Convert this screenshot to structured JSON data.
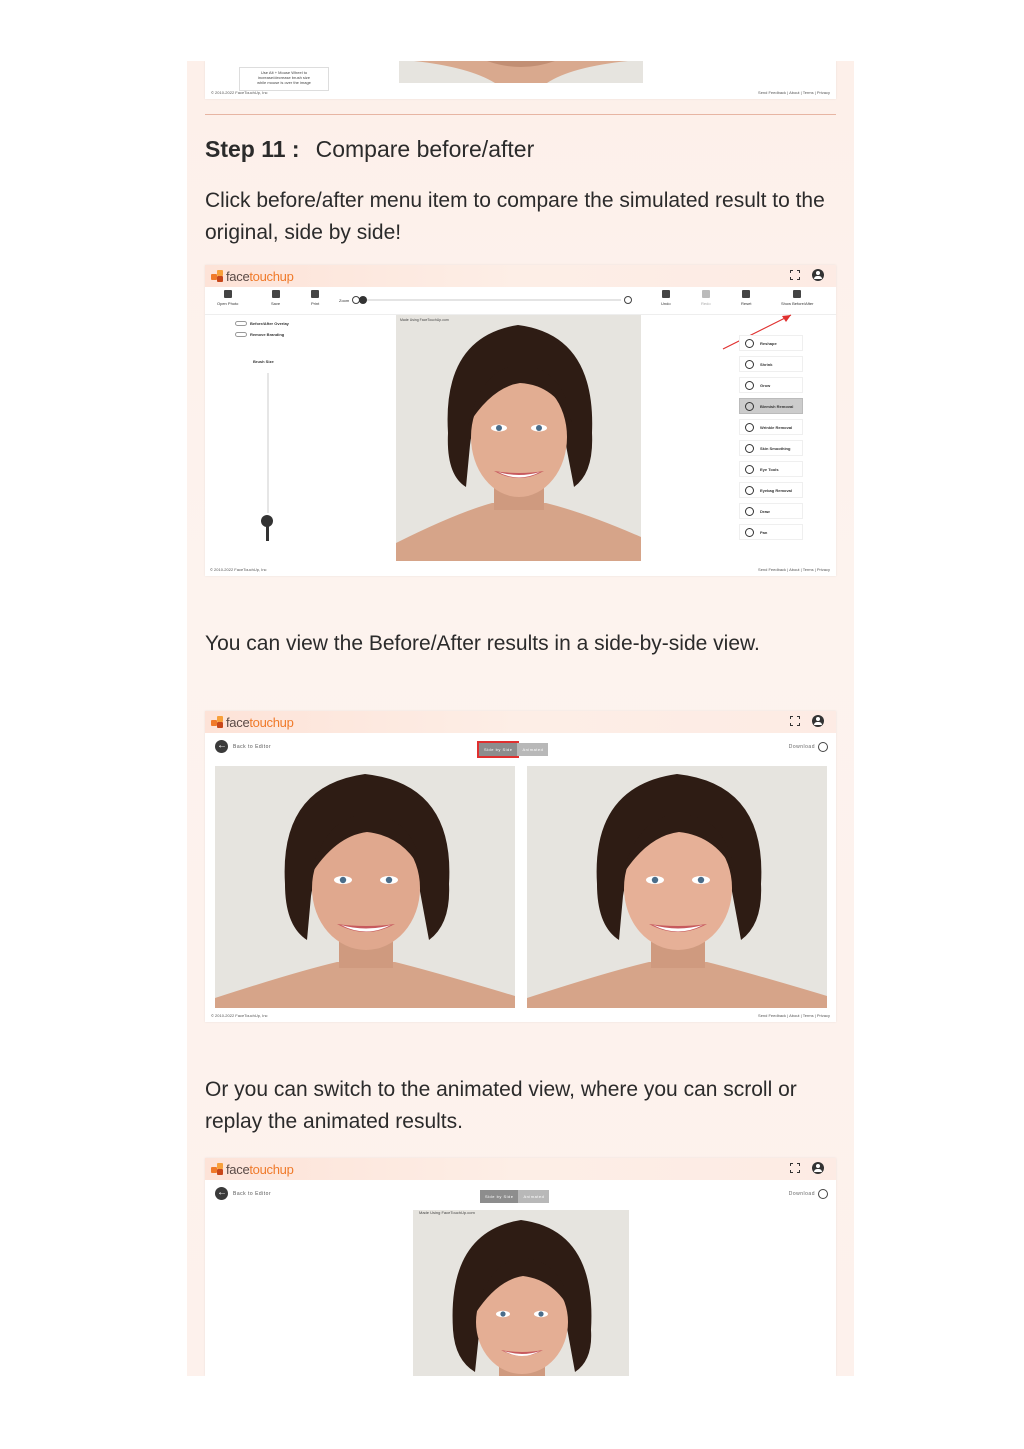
{
  "top_fragment": {
    "tip_line1": "Use Alt + Mouse Wheel to",
    "tip_line2": "increase/decrease brush size",
    "tip_line3": "while mouse is over the image",
    "copyright": "© 2010-2022 FaceTouchUp, Inc",
    "footer_links": "Send Feedback | About | Terms | Privacy"
  },
  "step": {
    "number": "Step 11 :",
    "title": "Compare before/after",
    "description": "Click before/after menu item to compare the simulated result to the original, side by side!"
  },
  "logo": {
    "part1": "face",
    "part2": "touchup"
  },
  "editor": {
    "toolbar": [
      "Open Photo",
      "Save",
      "Print",
      "Undo",
      "Redo",
      "Reset",
      "Show Before/After"
    ],
    "zoom_label": "Zoom",
    "toggles": [
      "Before/After Overlay",
      "Remove Branding"
    ],
    "brush_label": "Brush Size",
    "watermark": "Made Using FaceTouchUp.com",
    "tools": [
      "Reshape",
      "Shrink",
      "Grow",
      "Blemish Removal",
      "Wrinkle Removal",
      "Skin Smoothing",
      "Eye Tools",
      "Eyebag Removal",
      "Draw",
      "Pan"
    ],
    "active_tool": "Blemish Removal",
    "copyright": "© 2010-2022 FaceTouchUp, Inc",
    "footer_links": "Send Feedback | About | Terms | Privacy"
  },
  "para2": "You can view the Before/After results in a side-by-side view.",
  "side_by_side": {
    "back_label": "Back to Editor",
    "seg_side": "Side by Side",
    "seg_anim": "Animated",
    "download_label": "Download",
    "copyright": "© 2010-2022 FaceTouchUp, Inc",
    "footer_links": "Send Feedback | About | Terms | Privacy",
    "highlight_color": "#e0302f"
  },
  "para3": "Or you can switch to the animated view, where you can scroll or replay the animated results.",
  "animated": {
    "back_label": "Back to Editor",
    "seg_side": "Side by Side",
    "seg_anim": "Animated",
    "download_label": "Download",
    "watermark": "Made Using FaceTouchUp.com"
  }
}
